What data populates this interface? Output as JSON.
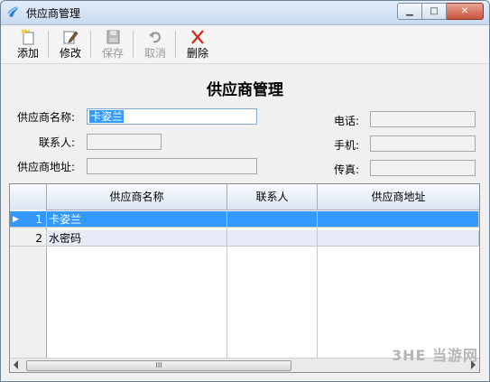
{
  "window": {
    "title": "供应商管理"
  },
  "toolbar": {
    "add": "添加",
    "edit": "修改",
    "save": "保存",
    "cancel": "取消",
    "delete": "删除"
  },
  "form": {
    "heading": "供应商管理",
    "supplier_name_label": "供应商名称:",
    "supplier_name_value": "卡姿兰",
    "contact_label": "联系人:",
    "contact_value": "",
    "address_label": "供应商地址:",
    "address_value": "",
    "phone_label": "电话:",
    "phone_value": "",
    "mobile_label": "手机:",
    "mobile_value": "",
    "fax_label": "传真:",
    "fax_value": ""
  },
  "grid": {
    "columns": [
      "供应商名称",
      "联系人",
      "供应商地址"
    ],
    "rows": [
      {
        "num": "1",
        "name": "卡姿兰",
        "contact": "",
        "address": ""
      },
      {
        "num": "2",
        "name": "水密码",
        "contact": "",
        "address": ""
      }
    ],
    "scroll_grip": "III"
  },
  "watermark": "3HE 当游网"
}
